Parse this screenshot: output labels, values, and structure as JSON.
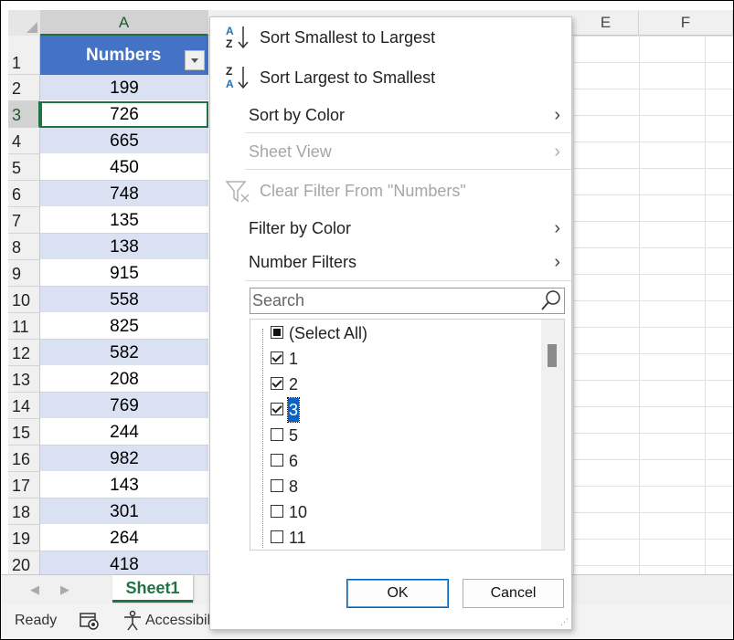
{
  "sheet": {
    "columns": [
      "A",
      "E",
      "F"
    ],
    "header_cell": "Numbers",
    "rows": [
      {
        "num": "1",
        "value": ""
      },
      {
        "num": "2",
        "value": "199"
      },
      {
        "num": "3",
        "value": "726"
      },
      {
        "num": "4",
        "value": "665"
      },
      {
        "num": "5",
        "value": "450"
      },
      {
        "num": "6",
        "value": "748"
      },
      {
        "num": "7",
        "value": "135"
      },
      {
        "num": "8",
        "value": "138"
      },
      {
        "num": "9",
        "value": "915"
      },
      {
        "num": "10",
        "value": "558"
      },
      {
        "num": "11",
        "value": "825"
      },
      {
        "num": "12",
        "value": "582"
      },
      {
        "num": "13",
        "value": "208"
      },
      {
        "num": "14",
        "value": "769"
      },
      {
        "num": "15",
        "value": "244"
      },
      {
        "num": "16",
        "value": "982"
      },
      {
        "num": "17",
        "value": "143"
      },
      {
        "num": "18",
        "value": "301"
      },
      {
        "num": "19",
        "value": "264"
      },
      {
        "num": "20",
        "value": "418"
      }
    ],
    "active_row": "3",
    "band_color": "#d9e1f2",
    "header_color": "#4472c4"
  },
  "tabs": {
    "active": "Sheet1"
  },
  "status": {
    "ready": "Ready",
    "accessibility": "Accessibil"
  },
  "menu": {
    "sort_asc": "Sort Smallest to Largest",
    "sort_desc": "Sort Largest to Smallest",
    "sort_by_color": "Sort by Color",
    "sheet_view": "Sheet View",
    "clear_filter": "Clear Filter From \"Numbers\"",
    "filter_by_color": "Filter by Color",
    "number_filters": "Number Filters",
    "search_placeholder": "Search",
    "items": [
      {
        "label": "(Select All)",
        "state": "partial"
      },
      {
        "label": "1",
        "state": "checked"
      },
      {
        "label": "2",
        "state": "checked"
      },
      {
        "label": "3",
        "state": "checked"
      },
      {
        "label": "5",
        "state": "unchecked"
      },
      {
        "label": "6",
        "state": "unchecked"
      },
      {
        "label": "8",
        "state": "unchecked"
      },
      {
        "label": "10",
        "state": "unchecked"
      },
      {
        "label": "11",
        "state": "unchecked"
      }
    ],
    "ok": "OK",
    "cancel": "Cancel"
  },
  "icons": {
    "sort_asc": "sort-ascending-icon",
    "sort_desc": "sort-descending-icon",
    "clear_filter": "clear-filter-icon",
    "submenu": "chevron-right-icon",
    "search": "search-icon",
    "accent": "#217346",
    "select_blue": "#0a64c8"
  }
}
